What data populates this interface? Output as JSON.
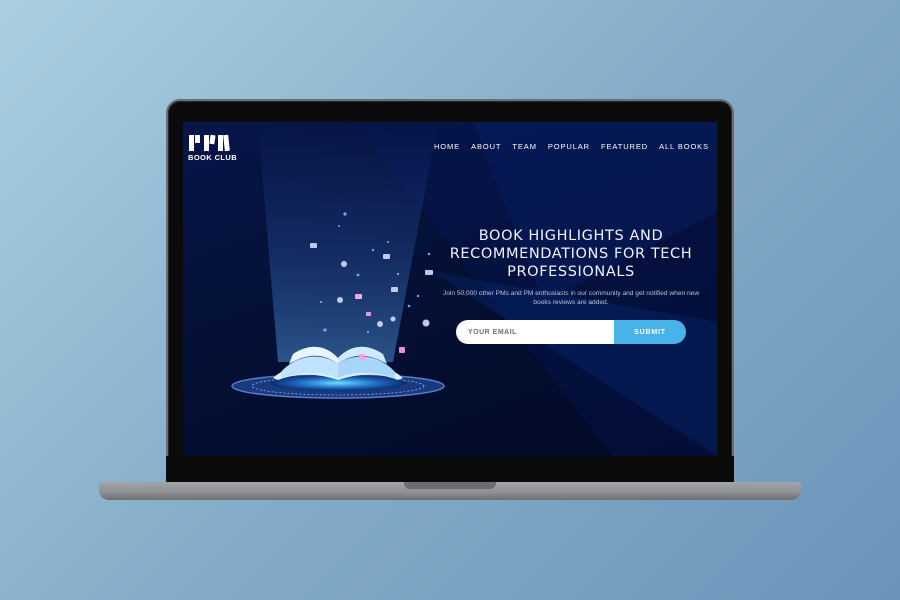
{
  "brand": {
    "logo_letters": "PM",
    "name": "BOOK CLUB"
  },
  "nav": {
    "items": [
      {
        "label": "HOME"
      },
      {
        "label": "ABOUT"
      },
      {
        "label": "TEAM"
      },
      {
        "label": "POPULAR"
      },
      {
        "label": "FEATURED"
      },
      {
        "label": "ALL BOOKS"
      }
    ]
  },
  "hero": {
    "title": "BOOK HIGHLIGHTS AND RECOMMENDATIONS FOR TECH PROFESSIONALS",
    "subtitle": "Join 50,000 other PMs and PM enthusiasts in our community and get notified when new books reviews are added.",
    "email_placeholder": "YOUR EMAIL",
    "submit_label": "SUBMIT"
  },
  "colors": {
    "background_gradient": [
      "#a9cfe0",
      "#6b94ba"
    ],
    "screen_bg": "#041035",
    "accent": "#48b3e8",
    "text": "#eef3ff"
  },
  "icons": {
    "illustration": "open-book-with-floating-icons-icon",
    "logo": "pm-bookshelf-logo-icon"
  }
}
